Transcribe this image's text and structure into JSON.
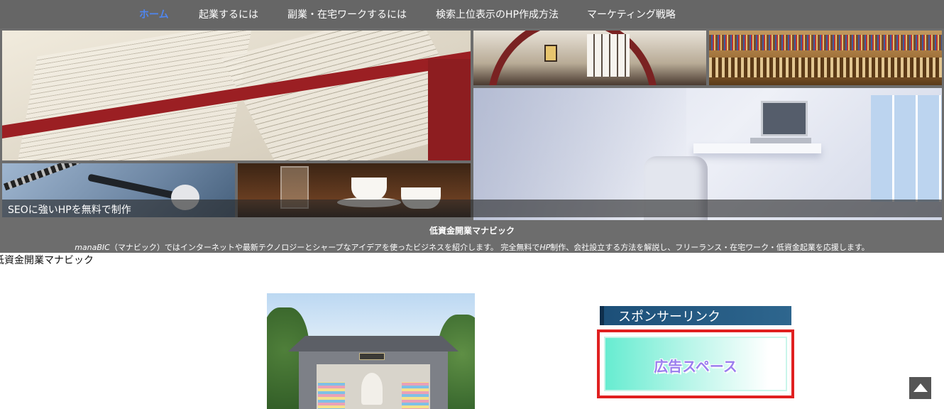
{
  "nav": {
    "items": [
      {
        "label": "ホーム",
        "active": true
      },
      {
        "label": "起業するには",
        "active": false
      },
      {
        "label": "副業・在宅ワークするには",
        "active": false
      },
      {
        "label": "検索上位表示のHP作成方法",
        "active": false
      },
      {
        "label": "マーケティング戦略",
        "active": false
      }
    ],
    "background": "#666666",
    "active_color": "#4f86f0"
  },
  "hero": {
    "caption": "SEOに強いHPを無料で制作",
    "site_title": "低資金開業マナビック",
    "description_brand": "manaBIC",
    "description_rest": "（マナビック）ではインターネットや最新テクノロジーとシャープなアイデアを使ったビジネスを紹介します。 完全無料で",
    "description_hp": "HP",
    "description_tail": "制作、会社設立する方法を解説し、フリーランス・在宅ワーク・低資金起業を応援します。"
  },
  "breadcrumb": {
    "text": "低資金開業マナビック"
  },
  "sidebar": {
    "sponsor_title": "スポンサーリンク",
    "ad_text": "広告スペース",
    "ad_border_color": "#e02020",
    "ad_text_color": "#9b7dee"
  },
  "icons": {
    "to_top": "arrow-up-icon"
  }
}
